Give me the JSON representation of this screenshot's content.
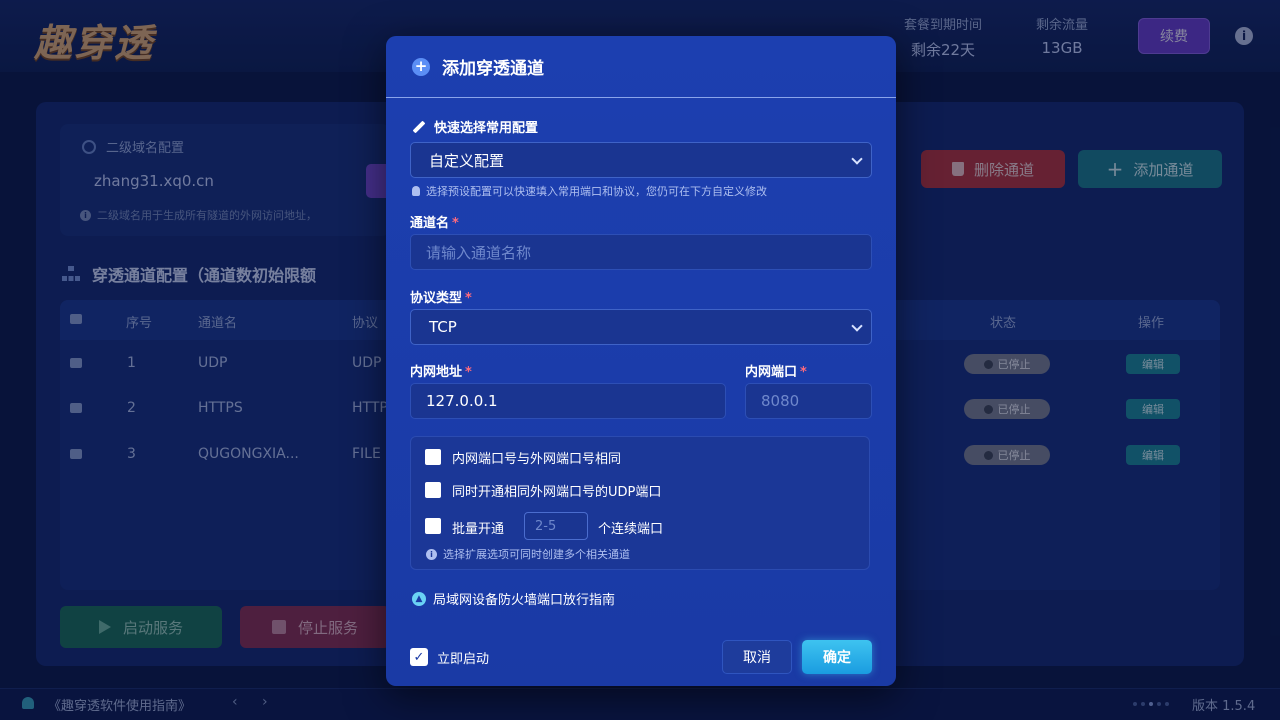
{
  "header": {
    "logo": "趣穿透",
    "plan_expiry_label": "套餐到期时间",
    "plan_expiry_value": "剩余22天",
    "traffic_label": "剩余流量",
    "traffic_value": "13GB",
    "renew_button": "续费",
    "info_icon": "i"
  },
  "domain": {
    "title": "二级域名配置",
    "value": "zhang31.xq0.cn",
    "hint": "二级域名用于生成所有隧道的外网访问地址，"
  },
  "actions": {
    "delete_channel": "删除通道",
    "add_channel": "添加通道"
  },
  "channels": {
    "section_title": "穿透通道配置（通道数初始限额",
    "headers": {
      "index": "序号",
      "name": "通道名",
      "protocol": "协议",
      "status": "状态",
      "actions": "操作"
    },
    "rows": [
      {
        "index": "1",
        "name": "UDP",
        "protocol": "UDP",
        "status": "已停止",
        "edit": "编辑"
      },
      {
        "index": "2",
        "name": "HTTPS",
        "protocol": "HTTP",
        "status": "已停止",
        "edit": "编辑"
      },
      {
        "index": "3",
        "name": "QUGONGXIA...",
        "protocol": "FILE",
        "status": "已停止",
        "edit": "编辑"
      }
    ]
  },
  "service": {
    "start": "启动服务",
    "stop": "停止服务"
  },
  "footer": {
    "guide": "《趣穿透软件使用指南》",
    "nav": "‹ ›",
    "version": "版本 1.5.4"
  },
  "modal": {
    "title": "添加穿透通道",
    "quick_config_label": "快速选择常用配置",
    "quick_config_value": "自定义配置",
    "quick_config_hint": "选择预设配置可以快速填入常用端口和协议，您仍可在下方自定义修改",
    "name_label": "通道名",
    "name_placeholder": "请输入通道名称",
    "protocol_label": "协议类型",
    "protocol_value": "TCP",
    "lan_address_label": "内网地址",
    "lan_address_value": "127.0.0.1",
    "lan_port_label": "内网端口",
    "lan_port_placeholder": "8080",
    "required_mark": "*",
    "option_same_port": "内网端口号与外网端口号相同",
    "option_udp": "同时开通相同外网端口号的UDP端口",
    "option_batch_prefix": "批量开通",
    "option_batch_placeholder": "2-5",
    "option_batch_suffix": "个连续端口",
    "options_hint": "选择扩展选项可同时创建多个相关通道",
    "firewall_guide": "局域网设备防火墙端口放行指南",
    "autostart_label": "立即启动",
    "cancel": "取消",
    "confirm": "确定"
  }
}
